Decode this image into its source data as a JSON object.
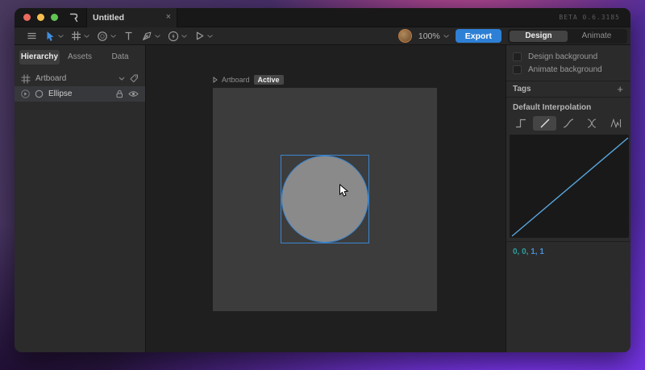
{
  "window": {
    "beta_label": "BETA 0.6.3185"
  },
  "titlebar": {
    "tab_title": "Untitled",
    "close_glyph": "×"
  },
  "toolbar": {
    "zoom_level": "100%",
    "export_label": "Export",
    "design_label": "Design",
    "animate_label": "Animate",
    "tools": [
      "menu",
      "select",
      "artboard",
      "shapes",
      "text",
      "pen",
      "bolt",
      "play"
    ]
  },
  "sidebar": {
    "tabs": [
      {
        "label": "Hierarchy",
        "active": true
      },
      {
        "label": "Assets",
        "active": false
      },
      {
        "label": "Data",
        "active": false
      }
    ],
    "items": [
      {
        "label": "Artboard",
        "icons": [
          "frame-icon",
          "chevron-down-icon",
          "tag-icon"
        ]
      },
      {
        "label": "Ellipse",
        "selected": true,
        "icons": [
          "disclosure-icon",
          "ellipse-icon",
          "lock-icon",
          "eye-icon"
        ]
      }
    ]
  },
  "canvas": {
    "artboard_label": "Artboard",
    "active_badge": "Active",
    "selected_shape": {
      "name": "Ellipse",
      "fill": "#8a8a8a"
    }
  },
  "panel": {
    "design_background_label": "Design background",
    "animate_background_label": "Animate background",
    "tags_label": "Tags",
    "add_glyph": "+",
    "interpolation_title": "Default Interpolation",
    "interpolation_modes": [
      "hold",
      "linear",
      "cubic",
      "cubic-symmetric",
      "elastic"
    ],
    "interpolation_selected": "linear",
    "values_in": "0, 0,",
    "values_out": "1, 1",
    "curve_points": [
      [
        0,
        0
      ],
      [
        1,
        1
      ]
    ]
  },
  "colors": {
    "accent_blue": "#2e80d6",
    "selection_blue": "#3b86d1",
    "curve_line": "#58a6dd",
    "value_in_teal": "#2e9e9e",
    "value_out_blue": "#4a8fd4",
    "artboard_gray": "#3c3c3c",
    "shape_gray": "#8a8a8a",
    "traffic_red": "#ec6a5e",
    "traffic_yellow": "#f5bf4f",
    "traffic_green": "#61c554"
  }
}
